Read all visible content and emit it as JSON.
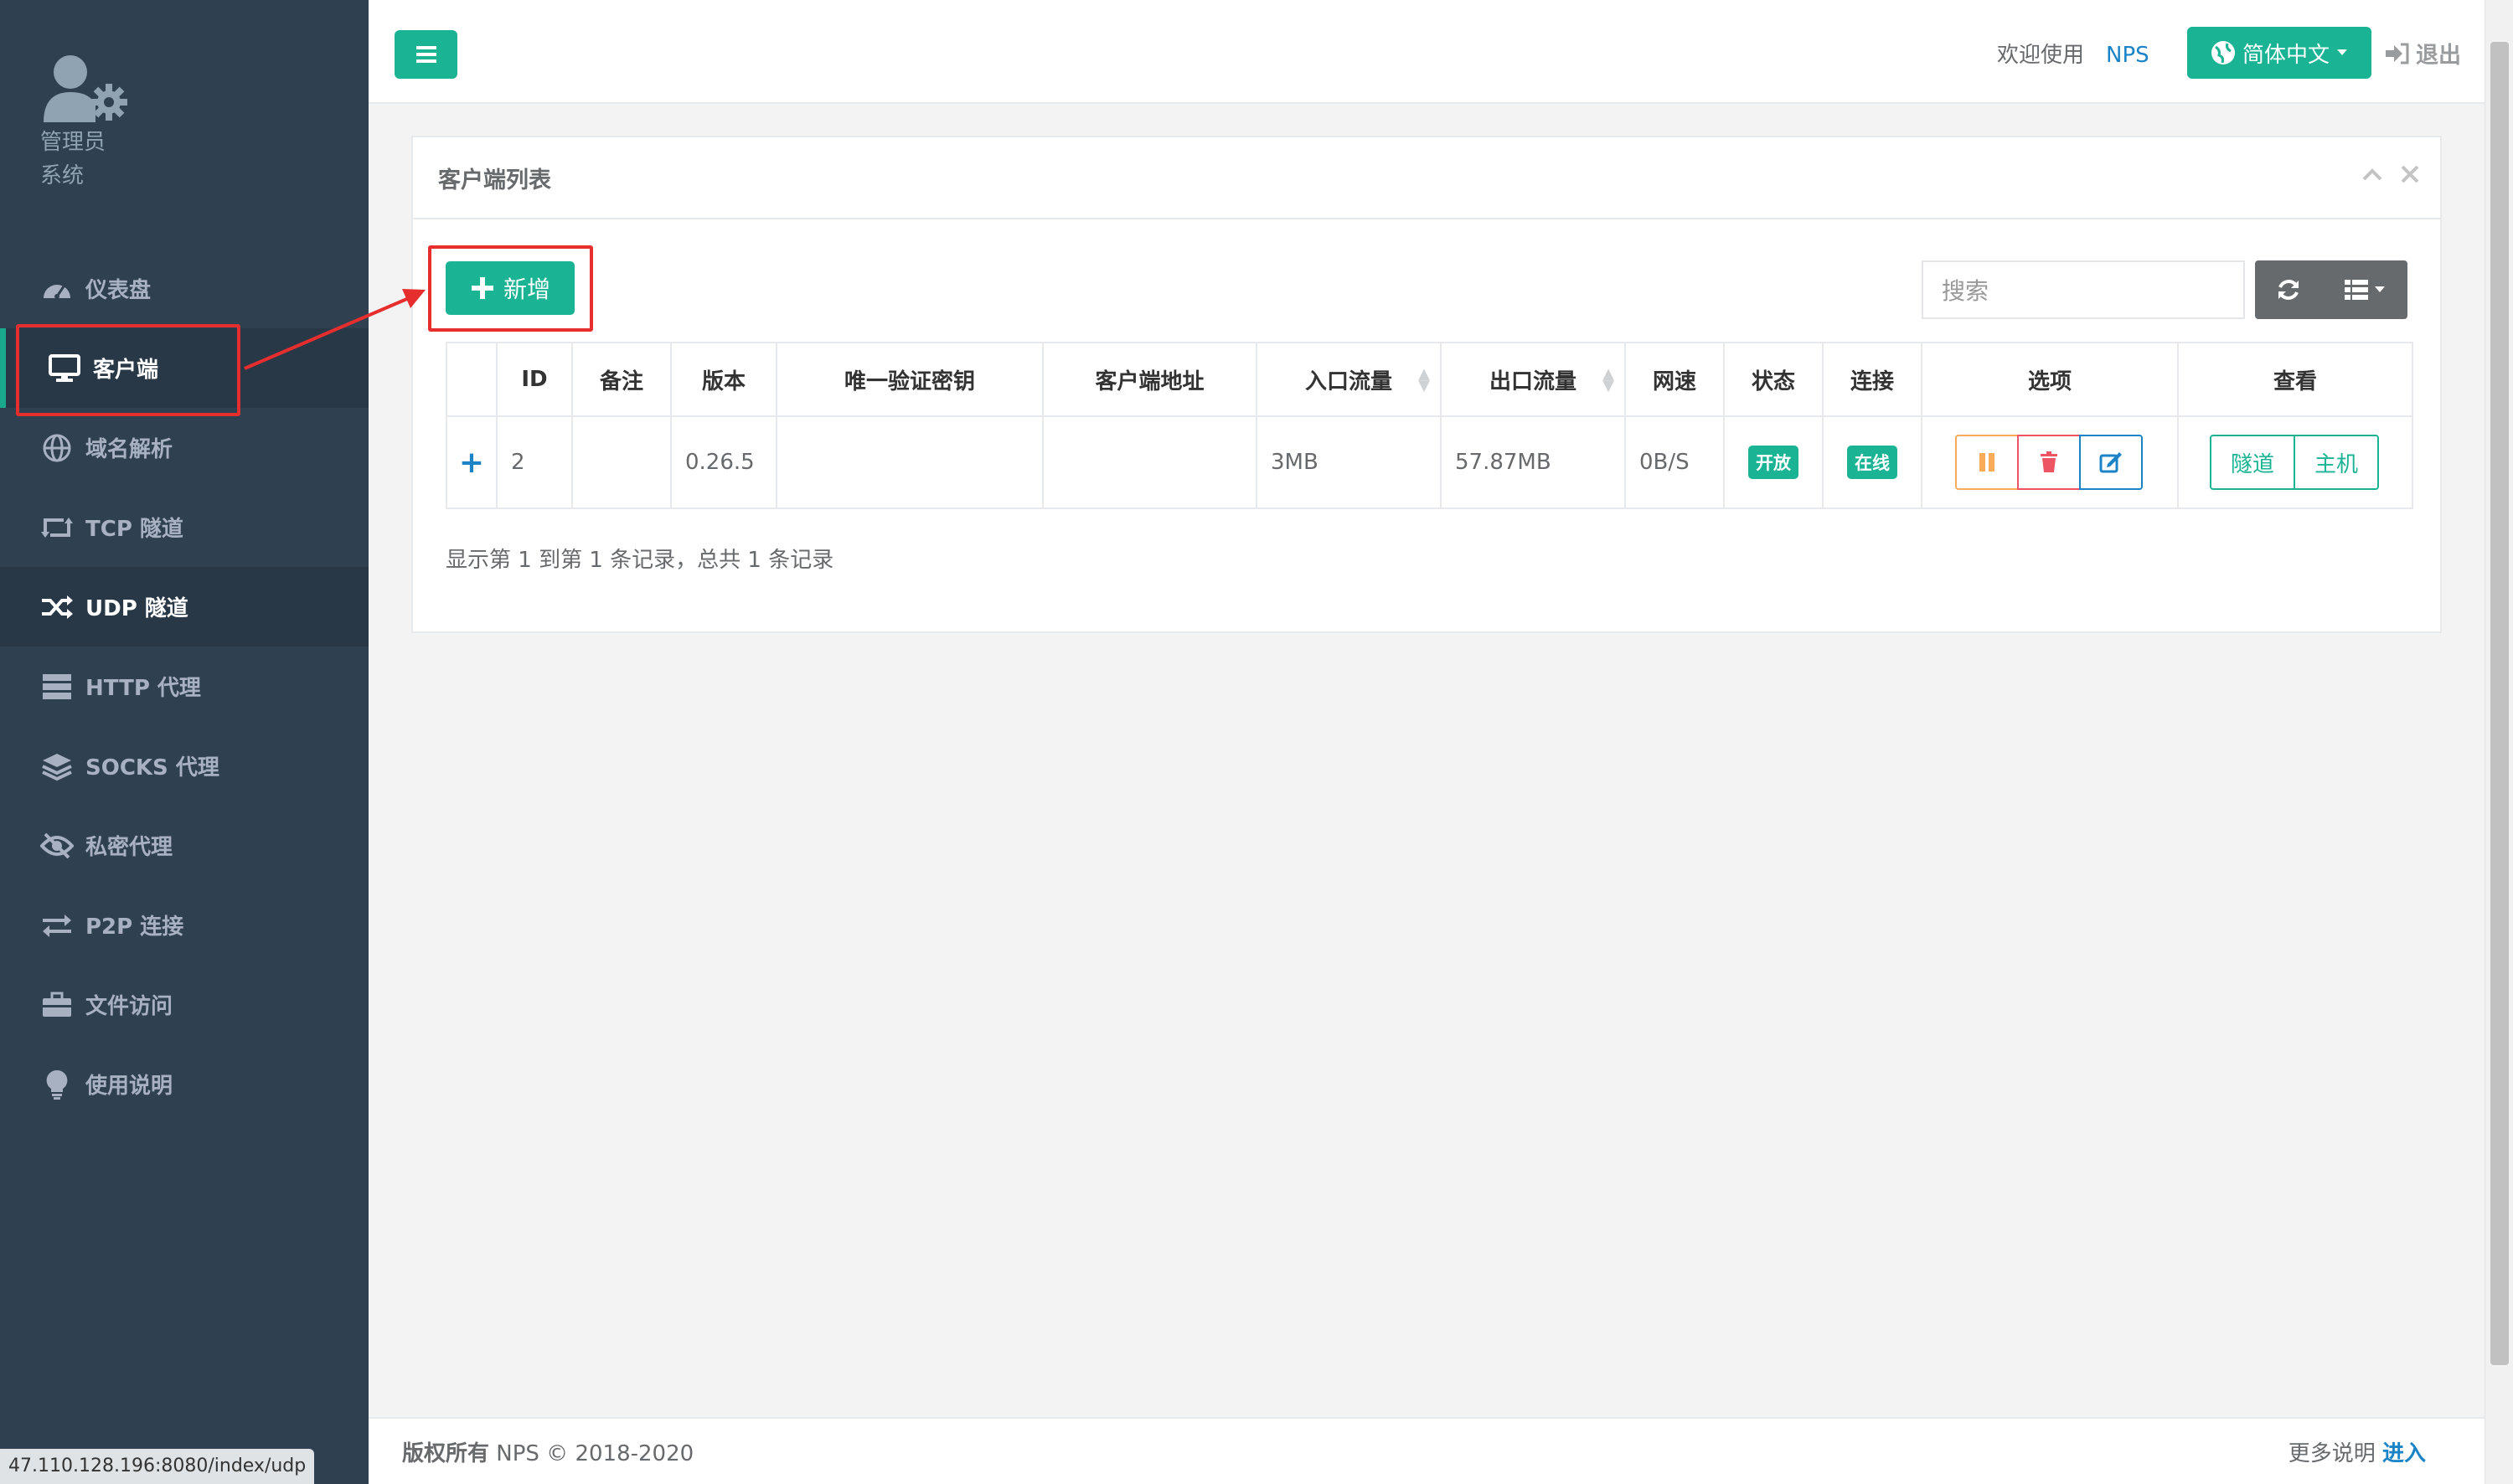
{
  "profile": {
    "line1": "管理员",
    "line2": "系统"
  },
  "sidebar": {
    "items": [
      {
        "label": "仪表盘",
        "icon": "dashboard-icon"
      },
      {
        "label": "客户端",
        "icon": "desktop-icon"
      },
      {
        "label": "域名解析",
        "icon": "globe-icon"
      },
      {
        "label": "TCP 隧道",
        "icon": "retweet-icon"
      },
      {
        "label": "UDP 隧道",
        "icon": "random-icon"
      },
      {
        "label": "HTTP 代理",
        "icon": "server-icon"
      },
      {
        "label": "SOCKS 代理",
        "icon": "layers-icon"
      },
      {
        "label": "私密代理",
        "icon": "eye-slash-icon"
      },
      {
        "label": "P2P 连接",
        "icon": "exchange-icon"
      },
      {
        "label": "文件访问",
        "icon": "briefcase-icon"
      },
      {
        "label": "使用说明",
        "icon": "lightbulb-icon"
      }
    ]
  },
  "status_url": "47.110.128.196:8080/index/udp",
  "topbar": {
    "welcome": "欢迎使用",
    "brand": "NPS",
    "language": "简体中文",
    "logout": "退出"
  },
  "panel": {
    "title": "客户端列表",
    "add_label": "新增",
    "search_placeholder": "搜索",
    "summary": "显示第 1 到第 1 条记录，总共 1 条记录"
  },
  "table": {
    "headers": [
      "",
      "ID",
      "备注",
      "版本",
      "唯一验证密钥",
      "客户端地址",
      "入口流量",
      "出口流量",
      "网速",
      "状态",
      "连接",
      "选项",
      "查看"
    ],
    "rows": [
      {
        "expand": "+",
        "id": "2",
        "remark": "",
        "version": "0.26.5",
        "vkey": "",
        "addr": "",
        "in_flow": "3MB",
        "out_flow": "57.87MB",
        "rate": "0B/S",
        "status": "开放",
        "connect": "在线",
        "view_tunnel": "隧道",
        "view_host": "主机"
      }
    ]
  },
  "footer": {
    "copyright_bold": "版权所有",
    "copyright_rest": "NPS © 2018-2020",
    "more": "更多说明",
    "enter": "进入"
  },
  "colors": {
    "sidebar_bg": "#2f4050",
    "primary": "#1ab394",
    "warning": "#f8ac59",
    "danger": "#ed5565",
    "info": "#1c84c6",
    "highlight_red": "#e62e2e"
  }
}
